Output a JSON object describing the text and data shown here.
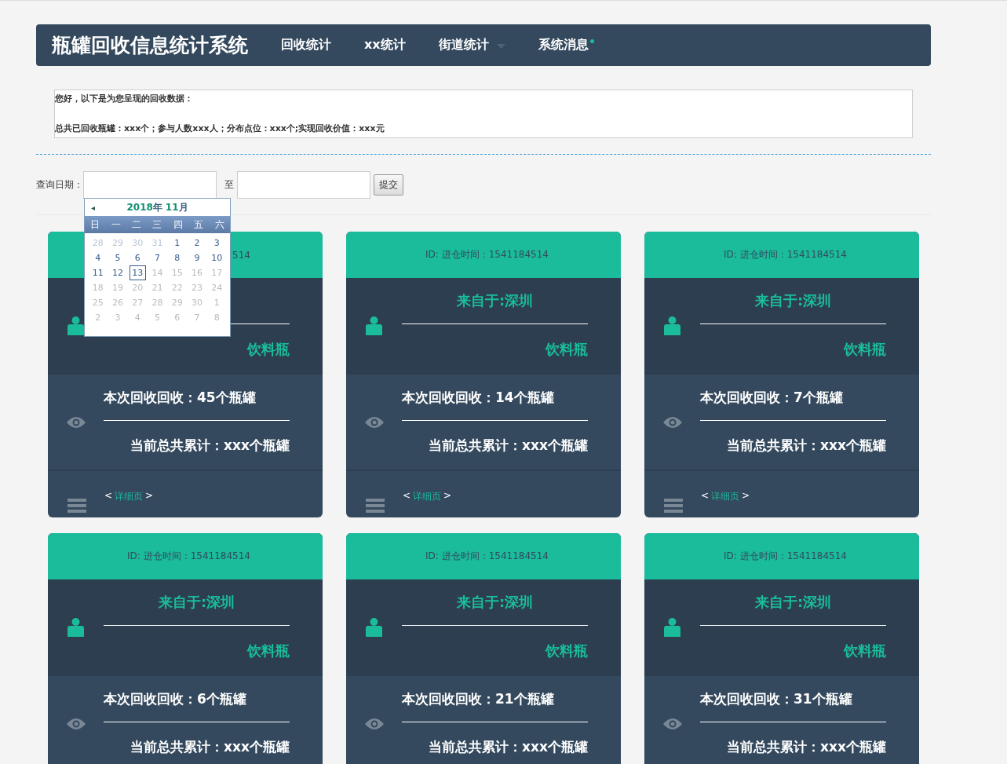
{
  "navbar": {
    "brand": "瓶罐回收信息统计系统",
    "items": [
      {
        "label": "回收统计",
        "dropdown": false,
        "dot": false
      },
      {
        "label": "xx统计",
        "dropdown": false,
        "dot": false
      },
      {
        "label": "街道统计",
        "dropdown": true,
        "dot": false
      },
      {
        "label": "系统消息",
        "dropdown": false,
        "dot": true
      }
    ]
  },
  "summary": {
    "greeting": "您好，以下是为您呈现的回收数据：",
    "stats": "总共已回收瓶罐：xxx个；参与人数xxx人；分布点位：xxx个;实现回收价值：xxx元"
  },
  "query": {
    "label": "查询日期：",
    "separator": "至",
    "submit": "提交"
  },
  "calendar": {
    "prev": "◂",
    "year": "2018",
    "year_unit": "年",
    "month": "11",
    "month_unit": "月",
    "weekdays": [
      "日",
      "一",
      "二",
      "三",
      "四",
      "五",
      "六"
    ],
    "days": [
      {
        "label": "28",
        "kind": "other"
      },
      {
        "label": "29",
        "kind": "other"
      },
      {
        "label": "30",
        "kind": "other"
      },
      {
        "label": "31",
        "kind": "other"
      },
      {
        "label": "1",
        "kind": "active"
      },
      {
        "label": "2",
        "kind": "active"
      },
      {
        "label": "3",
        "kind": "active"
      },
      {
        "label": "4",
        "kind": "active"
      },
      {
        "label": "5",
        "kind": "active"
      },
      {
        "label": "6",
        "kind": "active"
      },
      {
        "label": "7",
        "kind": "active"
      },
      {
        "label": "8",
        "kind": "active"
      },
      {
        "label": "9",
        "kind": "active"
      },
      {
        "label": "10",
        "kind": "active"
      },
      {
        "label": "11",
        "kind": "active"
      },
      {
        "label": "12",
        "kind": "active"
      },
      {
        "label": "13",
        "kind": "today"
      },
      {
        "label": "14",
        "kind": "disabled"
      },
      {
        "label": "15",
        "kind": "disabled"
      },
      {
        "label": "16",
        "kind": "disabled"
      },
      {
        "label": "17",
        "kind": "disabled"
      },
      {
        "label": "18",
        "kind": "disabled"
      },
      {
        "label": "19",
        "kind": "disabled"
      },
      {
        "label": "20",
        "kind": "disabled"
      },
      {
        "label": "21",
        "kind": "disabled"
      },
      {
        "label": "22",
        "kind": "disabled"
      },
      {
        "label": "23",
        "kind": "disabled"
      },
      {
        "label": "24",
        "kind": "disabled"
      },
      {
        "label": "25",
        "kind": "disabled"
      },
      {
        "label": "26",
        "kind": "disabled"
      },
      {
        "label": "27",
        "kind": "disabled"
      },
      {
        "label": "28",
        "kind": "disabled"
      },
      {
        "label": "29",
        "kind": "disabled"
      },
      {
        "label": "30",
        "kind": "disabled"
      },
      {
        "label": "1",
        "kind": "disabled"
      },
      {
        "label": "2",
        "kind": "disabled"
      },
      {
        "label": "3",
        "kind": "disabled"
      },
      {
        "label": "4",
        "kind": "disabled"
      },
      {
        "label": "5",
        "kind": "disabled"
      },
      {
        "label": "6",
        "kind": "disabled"
      },
      {
        "label": "7",
        "kind": "disabled"
      },
      {
        "label": "8",
        "kind": "disabled"
      }
    ]
  },
  "cards": [
    {
      "header": "514",
      "type": "饮料瓶",
      "this_time": "本次回收回收：45个瓶罐",
      "total": "当前总共累计：xxx个瓶罐",
      "link_open": "<",
      "link": "详细页",
      "link_close": ">"
    },
    {
      "header": "ID:  进仓时间：1541184514",
      "from": "来自于:深圳",
      "type": "饮料瓶",
      "this_time": "本次回收回收：14个瓶罐",
      "total": "当前总共累计：xxx个瓶罐",
      "link_open": "<",
      "link": "详细页",
      "link_close": ">"
    },
    {
      "header": "ID:  进仓时间：1541184514",
      "from": "来自于:深圳",
      "type": "饮料瓶",
      "this_time": "本次回收回收：7个瓶罐",
      "total": "当前总共累计：xxx个瓶罐",
      "link_open": "<",
      "link": "详细页",
      "link_close": ">"
    },
    {
      "header": "ID:  进仓时间：1541184514",
      "from": "来自于:深圳",
      "type": "饮料瓶",
      "this_time": "本次回收回收：6个瓶罐",
      "total": "当前总共累计：xxx个瓶罐"
    },
    {
      "header": "ID:  进仓时间：1541184514",
      "from": "来自于:深圳",
      "type": "饮料瓶",
      "this_time": "本次回收回收：21个瓶罐",
      "total": "当前总共累计：xxx个瓶罐"
    },
    {
      "header": "ID:  进仓时间：1541184514",
      "from": "来自于:深圳",
      "type": "饮料瓶",
      "this_time": "本次回收回收：31个瓶罐",
      "total": "当前总共累计：xxx个瓶罐"
    }
  ]
}
